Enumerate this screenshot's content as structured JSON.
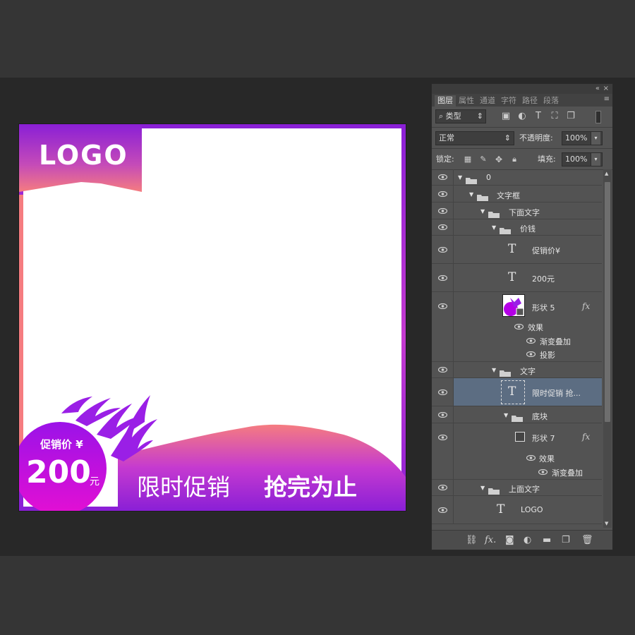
{
  "canvas": {
    "logo": "LOGO",
    "promo_label": "促销价 ¥",
    "price": "200",
    "price_unit": "元",
    "slogan_regular": "限时促销",
    "slogan_bold": "抢完为止",
    "colors": {
      "purple": "#8a1fd6",
      "magenta": "#c53ad0",
      "pink": "#f57c80",
      "circle": "#b400e6"
    }
  },
  "panel": {
    "tabs": [
      "图层",
      "属性",
      "通道",
      "字符",
      "路径",
      "段落"
    ],
    "filter": {
      "label": "类型"
    },
    "blend_mode": "正常",
    "opacity_label": "不透明度:",
    "opacity_value": "100%",
    "lock_label": "锁定:",
    "fill_label": "填充:",
    "fill_value": "100%",
    "layers": [
      {
        "name": "0"
      },
      {
        "name": "文字框"
      },
      {
        "name": "下面文字"
      },
      {
        "name": "价钱"
      },
      {
        "name": "促销价¥"
      },
      {
        "name": "200元"
      },
      {
        "name": "形状 5"
      },
      {
        "name": "效果"
      },
      {
        "name": "渐变叠加"
      },
      {
        "name": "投影"
      },
      {
        "name": "文字"
      },
      {
        "name": "限时促销 抢..."
      },
      {
        "name": "底块"
      },
      {
        "name": "形状 7"
      },
      {
        "name": "效果"
      },
      {
        "name": "渐变叠加"
      },
      {
        "name": "上面文字"
      },
      {
        "name": "LOGO"
      }
    ],
    "fx_label": "fx"
  }
}
